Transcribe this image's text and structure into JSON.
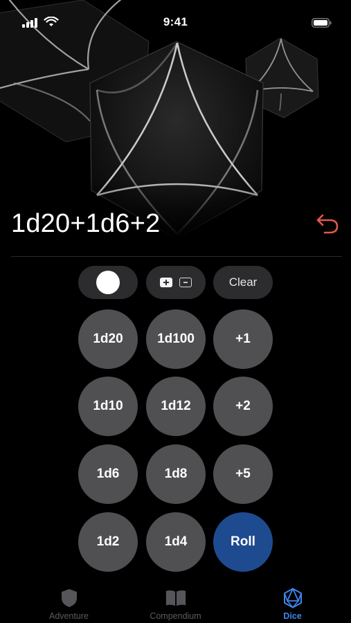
{
  "status_bar": {
    "time": "9:41",
    "icons": [
      "cellular-signal-icon",
      "wifi-icon",
      "battery-icon"
    ]
  },
  "illustration": "dice-background",
  "roll": {
    "expression": "1d20+1d6+2",
    "undo_icon": "undo-arrow-icon",
    "undo_color": "#e5574b"
  },
  "keypad": {
    "toggles": {
      "color_toggle_icon": "white-dot-icon",
      "sign_toggle_icons": [
        "plus-square-icon",
        "minus-square-icon"
      ],
      "clear_label": "Clear"
    },
    "rows": [
      [
        "1d20",
        "1d100",
        "+1"
      ],
      [
        "1d10",
        "1d12",
        "+2"
      ],
      [
        "1d6",
        "1d8",
        "+5"
      ],
      [
        "1d2",
        "1d4",
        "Roll"
      ]
    ],
    "roll_color": "#1e4b8f"
  },
  "tab_bar": {
    "tabs": [
      {
        "label": "Adventure",
        "icon": "shield-icon",
        "active": false
      },
      {
        "label": "Compendium",
        "icon": "book-icon",
        "active": false
      },
      {
        "label": "Dice",
        "icon": "d20-icon",
        "active": true
      }
    ],
    "active_color": "#3f86f0"
  }
}
